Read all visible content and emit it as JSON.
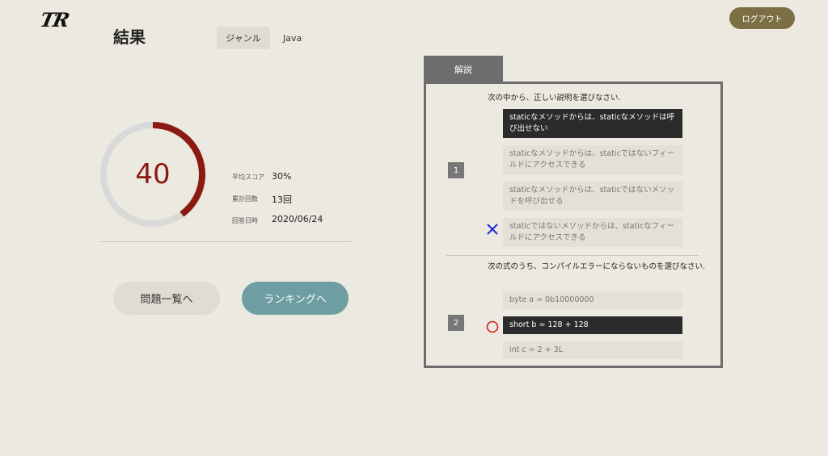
{
  "header": {
    "logo": "TR",
    "logout_label": "ログアウト"
  },
  "page": {
    "title": "結果",
    "genre_label": "ジャンル",
    "genre_value": "Java"
  },
  "score": {
    "value": "40",
    "progress": 0.4,
    "colors": {
      "arc": "#8b1a12",
      "track": "#d9d9d9"
    },
    "stats": [
      {
        "label": "平均スコア",
        "value": "30%"
      },
      {
        "label": "累計回数",
        "value": "13回"
      },
      {
        "label": "回答日時",
        "value": "2020/06/24"
      }
    ]
  },
  "actions": {
    "list_label": "問題一覧へ",
    "ranking_label": "ランキングへ"
  },
  "explanation": {
    "tab_label": "解説",
    "questions": [
      {
        "number": "1",
        "text": "次の中から、正しい説明を選びなさい.",
        "mark": "cross-icon",
        "options": [
          {
            "text": "staticなメソッドからは、staticなメソッドは呼び出せない",
            "selected": true
          },
          {
            "text": "staticなメソッドからは、staticではないフィールドにアクセスできる",
            "selected": false
          },
          {
            "text": "staticなメソッドからは、staticではないメソッドを呼び出せる",
            "selected": false
          },
          {
            "text": "staticではないメソッドからは、staticなフィールドにアクセスできる",
            "selected": false
          }
        ]
      },
      {
        "number": "2",
        "text": "次の式のうち、コンパイルエラーにならないものを選びなさい.",
        "mark": "circle-icon",
        "options": [
          {
            "text": "byte a = 0b10000000",
            "selected": false
          },
          {
            "text": "short b = 128 + 128",
            "selected": true
          },
          {
            "text": "int c = 2 + 3L",
            "selected": false
          }
        ]
      }
    ]
  }
}
